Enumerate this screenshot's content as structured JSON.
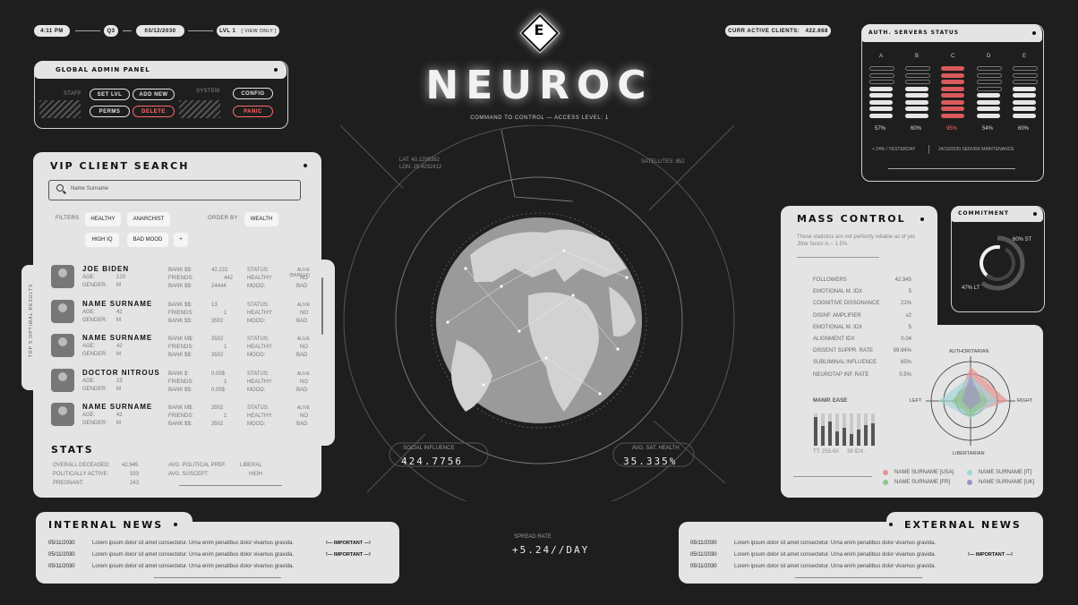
{
  "topbar": {
    "time": "4:11 PM",
    "quarter": "Q3",
    "date": "03/12/2030",
    "level": "LVL 1",
    "view_only": "[ VIEW ONLY ]",
    "clients_label": "CURR ACTIVE CLIENTS:",
    "clients_value": "422.668"
  },
  "brand": {
    "logo_letter": "E",
    "title": "NEUROC",
    "subtitle": "COMMAND TO CONTROL — ACCESS LEVEL: 1"
  },
  "admin": {
    "title": "GLOBAL ADMIN PANEL",
    "staff": "STAFF",
    "system": "SYSTEM",
    "set_lvl": "SET LVL",
    "add_new": "ADD NEW",
    "perms": "PERMS",
    "delete": "DELETE",
    "config": "CONFIG",
    "panic": "PANIC"
  },
  "vip": {
    "title": "VIP CLIENT SEARCH",
    "search_placeholder": "Name Surname",
    "filters": "FILTERS",
    "order_by": "ORDER BY",
    "chip_healthy": "HEALTHY",
    "chip_anarchist": "ANARCHIST",
    "chip_wealth": "WEALTH",
    "chip_highiq": "HIGH IQ",
    "chip_badmood": "BAD MOOD",
    "chip_plus": "+",
    "side_label": "TOP 5 OPTIMAL RESULTS",
    "clients": [
      {
        "name": "JOE BIDEN",
        "age": "120",
        "gender": "M",
        "bank1_l": "BANK $$:",
        "bank1": "42.222",
        "friends": "442",
        "bank2_l": "BANK $$:",
        "bank2": "24444",
        "status": "ALIVE (BARELY)",
        "healthy": "NO",
        "mood": "BAD"
      },
      {
        "name": "NAME SURNAME",
        "age": "42",
        "gender": "M",
        "bank1_l": "BANK $$:",
        "bank1": "13",
        "friends": "1",
        "bank2_l": "BANK $$:",
        "bank2": "3502",
        "status": "ALIVE",
        "healthy": "NO",
        "mood": "BAD"
      },
      {
        "name": "NAME SURNAME",
        "age": "42",
        "gender": "M",
        "bank1_l": "BANK M$:",
        "bank1": "3502",
        "friends": "1",
        "bank2_l": "BANK $$:",
        "bank2": "3502",
        "status": "ALIVE",
        "healthy": "NO",
        "mood": "BAD"
      },
      {
        "name": "DOCTOR NITROUS",
        "age": "23",
        "gender": "M",
        "bank1_l": "BANK $:",
        "bank1": "0.05$",
        "friends": "1",
        "bank2_l": "BANK $$:",
        "bank2": "0.05$",
        "status": "ALIVE",
        "healthy": "NO",
        "mood": "BAD"
      },
      {
        "name": "NAME SURNAME",
        "age": "42",
        "gender": "M",
        "bank1_l": "BANK M$:",
        "bank1": "3502",
        "friends": "1",
        "bank2_l": "BANK $$:",
        "bank2": "3502",
        "status": "ALIVE",
        "healthy": "NO",
        "mood": "BAD"
      }
    ],
    "labels": {
      "age": "AGE:",
      "gender": "GENDER:",
      "friends": "FRIENDS:",
      "status": "STATUS:",
      "healthy": "HEALTHY:",
      "mood": "MOOD:"
    },
    "stats_title": "STATS",
    "stats": {
      "deceased_l": "OVERALL DECEASED:",
      "deceased": "42.945",
      "political_l": "POLITICALLY ACTIVE:",
      "political": "333",
      "pregnant_l": "PREGNANT:",
      "pregnant": "243",
      "pref_l": "AVG. POLITICAL PREF.",
      "pref": "LIBERAL",
      "suscept_l": "AVG. SUSCEPT:",
      "suscept": "HIGH"
    }
  },
  "globe": {
    "lat": "LAT: 40.1295392",
    "lon": "LON: 25.4232412",
    "satellites": "SATELLITES: 852",
    "social_l": "SOCIAL INFLUENCE",
    "social": "424.7756",
    "health_l": "AVG. SAT. HEALTH",
    "health": "35.335%",
    "spread_l": "SPREAD RATE",
    "spread": "+5.24//DAY"
  },
  "servers": {
    "title": "AUTH. SERVERS STATUS",
    "cols": [
      "A",
      "B",
      "C",
      "D",
      "E"
    ],
    "fill": [
      0.57,
      0.6,
      0.95,
      0.54,
      0.6
    ],
    "pcts": [
      "57%",
      "60%",
      "95%",
      "54%",
      "60%"
    ],
    "note1": "+ 24% / YESTERDAY",
    "note2": "24/10/2030 SERVER MAINTENANCE"
  },
  "mass": {
    "title": "MASS CONTROL",
    "note": "These statistics are not perfectly reliable as of yet. Jitter factor is ~ 1.5%.",
    "metrics": [
      [
        "FOLLOWERS",
        "42.945"
      ],
      [
        "EMOTIONAL M. IDX",
        "5"
      ],
      [
        "COGNITIVE DISSONANCE",
        "21%"
      ],
      [
        "DISINF. AMPLIFIER",
        "x2"
      ],
      [
        "EMOTIONAL M. IDX",
        "5"
      ],
      [
        "ALIGNMENT IDX",
        "0.04"
      ],
      [
        "DISSENT SUPPR. RATE",
        "99.94%"
      ],
      [
        "SUBLIMINAL INFLUENCE",
        "65%"
      ],
      [
        "NEUROTAP INF. RATE",
        "0.5%"
      ]
    ],
    "manip_title": "MANIP. EASE",
    "manip_fill": [
      0.9,
      0.6,
      0.75,
      0.45,
      0.55,
      0.35,
      0.5,
      0.65,
      0.7
    ],
    "manip_tt": "TT: 253.4X",
    "manip_idx": "39 IDX.",
    "radar_top": "AUTHORITARIAN",
    "radar_bottom": "LIBERTARIAN",
    "radar_left": "LEFT",
    "radar_right": "RIGHT",
    "legend": [
      {
        "name": "NAME SURNAME [USA]",
        "color": "#e59393"
      },
      {
        "name": "NAME SURNAME [IT]",
        "color": "#9fd6d9"
      },
      {
        "name": "NAME SURNAME [FR]",
        "color": "#8fc48f"
      },
      {
        "name": "NAME SURNAME [UK]",
        "color": "#9d8fc4"
      }
    ]
  },
  "commitment": {
    "title": "COMMITMENT",
    "st": "60% ST",
    "lt": "47% LT"
  },
  "internal": {
    "title": "INTERNAL NEWS",
    "items": [
      {
        "date": "05/11/2030",
        "text": "Lorem ipsum dolor sit amet consectetur. Urna enim penatibus dolor vivamus gravida.",
        "tag": "!— IMPORTANT —!"
      },
      {
        "date": "05/11/2030",
        "text": "Lorem ipsum dolor sit amet consectetur. Urna enim penatibus dolor vivamus gravida.",
        "tag": "!— IMPORTANT —!"
      },
      {
        "date": "05/11/2030",
        "text": "Lorem ipsum dolor sit amet consectetur. Urna enim penatibus dolor vivamus gravida.",
        "tag": ""
      }
    ]
  },
  "external": {
    "title": "EXTERNAL NEWS",
    "items": [
      {
        "date": "05/11/2030",
        "text": "Lorem ipsum dolor sit amet consectetur. Urna enim penatibus dolor vivamus gravida.",
        "tag": ""
      },
      {
        "date": "05/11/2030",
        "text": "Lorem ipsum dolor sit amet consectetur. Urna enim penatibus dolor vivamus gravida.",
        "tag": "!— IMPORTANT —!"
      },
      {
        "date": "05/11/2030",
        "text": "Lorem ipsum dolor sit amet consectetur. Urna enim penatibus dolor vivamus gravida.",
        "tag": ""
      }
    ]
  }
}
